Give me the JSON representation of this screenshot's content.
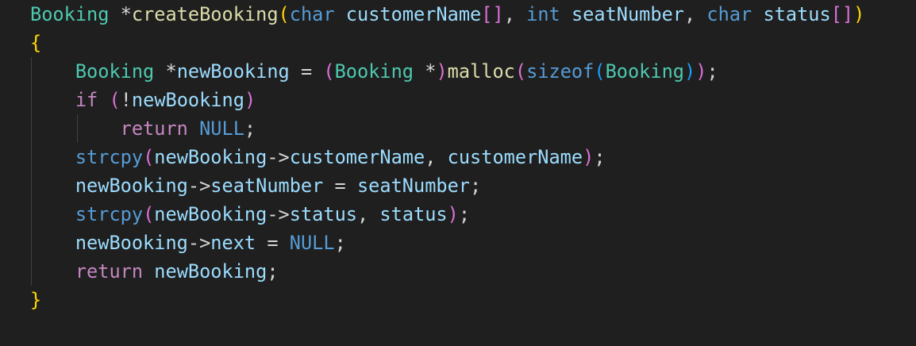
{
  "editor": {
    "colors": {
      "background": "#1f1f1f",
      "type": "#4ec9b0",
      "keyword": "#569cd6",
      "control": "#c586c0",
      "function": "#dcdcaa",
      "variable": "#9cdcfe",
      "text": "#d4d4d4",
      "bracket1": "#ffd700",
      "bracket2": "#da70d6",
      "bracket3": "#179fff",
      "guide": "#404040"
    },
    "lines": [
      [
        [
          "Booking",
          "type"
        ],
        [
          " *",
          "text"
        ],
        [
          "createBooking",
          "function"
        ],
        [
          "(",
          "bracket1"
        ],
        [
          "char",
          "keyword"
        ],
        [
          " ",
          "text"
        ],
        [
          "customerName",
          "variable"
        ],
        [
          "[]",
          "bracket2"
        ],
        [
          ", ",
          "text"
        ],
        [
          "int",
          "keyword"
        ],
        [
          " ",
          "text"
        ],
        [
          "seatNumber",
          "variable"
        ],
        [
          ", ",
          "text"
        ],
        [
          "char",
          "keyword"
        ],
        [
          " ",
          "text"
        ],
        [
          "status",
          "variable"
        ],
        [
          "[]",
          "bracket2"
        ],
        [
          ")",
          "bracket1"
        ]
      ],
      [
        [
          "{",
          "bracket1"
        ]
      ],
      [
        [
          "    ",
          "text"
        ],
        [
          "Booking",
          "type"
        ],
        [
          " *",
          "text"
        ],
        [
          "newBooking",
          "variable"
        ],
        [
          " = ",
          "text"
        ],
        [
          "(",
          "bracket2"
        ],
        [
          "Booking",
          "type"
        ],
        [
          " *",
          "text"
        ],
        [
          ")",
          "bracket2"
        ],
        [
          "malloc",
          "function"
        ],
        [
          "(",
          "bracket2"
        ],
        [
          "sizeof",
          "keyword"
        ],
        [
          "(",
          "bracket3"
        ],
        [
          "Booking",
          "type"
        ],
        [
          ")",
          "bracket3"
        ],
        [
          ")",
          "bracket2"
        ],
        [
          ";",
          "text"
        ]
      ],
      [
        [
          "    ",
          "text"
        ],
        [
          "if",
          "control"
        ],
        [
          " ",
          "text"
        ],
        [
          "(",
          "bracket2"
        ],
        [
          "!",
          "text"
        ],
        [
          "newBooking",
          "variable"
        ],
        [
          ")",
          "bracket2"
        ]
      ],
      [
        [
          "        ",
          "text"
        ],
        [
          "return",
          "control"
        ],
        [
          " ",
          "text"
        ],
        [
          "NULL",
          "keyword"
        ],
        [
          ";",
          "text"
        ]
      ],
      [
        [
          "    ",
          "text"
        ],
        [
          "strcpy",
          "keyword"
        ],
        [
          "(",
          "bracket2"
        ],
        [
          "newBooking",
          "variable"
        ],
        [
          "->",
          "text"
        ],
        [
          "customerName",
          "variable"
        ],
        [
          ", ",
          "text"
        ],
        [
          "customerName",
          "variable"
        ],
        [
          ")",
          "bracket2"
        ],
        [
          ";",
          "text"
        ]
      ],
      [
        [
          "    ",
          "text"
        ],
        [
          "newBooking",
          "variable"
        ],
        [
          "->",
          "text"
        ],
        [
          "seatNumber",
          "variable"
        ],
        [
          " = ",
          "text"
        ],
        [
          "seatNumber",
          "variable"
        ],
        [
          ";",
          "text"
        ]
      ],
      [
        [
          "    ",
          "text"
        ],
        [
          "strcpy",
          "keyword"
        ],
        [
          "(",
          "bracket2"
        ],
        [
          "newBooking",
          "variable"
        ],
        [
          "->",
          "text"
        ],
        [
          "status",
          "variable"
        ],
        [
          ", ",
          "text"
        ],
        [
          "status",
          "variable"
        ],
        [
          ")",
          "bracket2"
        ],
        [
          ";",
          "text"
        ]
      ],
      [
        [
          "    ",
          "text"
        ],
        [
          "newBooking",
          "variable"
        ],
        [
          "->",
          "text"
        ],
        [
          "next",
          "variable"
        ],
        [
          " = ",
          "text"
        ],
        [
          "NULL",
          "keyword"
        ],
        [
          ";",
          "text"
        ]
      ],
      [
        [
          "    ",
          "text"
        ],
        [
          "return",
          "control"
        ],
        [
          " ",
          "text"
        ],
        [
          "newBooking",
          "variable"
        ],
        [
          ";",
          "text"
        ]
      ],
      [
        [
          "}",
          "bracket1"
        ]
      ]
    ]
  }
}
